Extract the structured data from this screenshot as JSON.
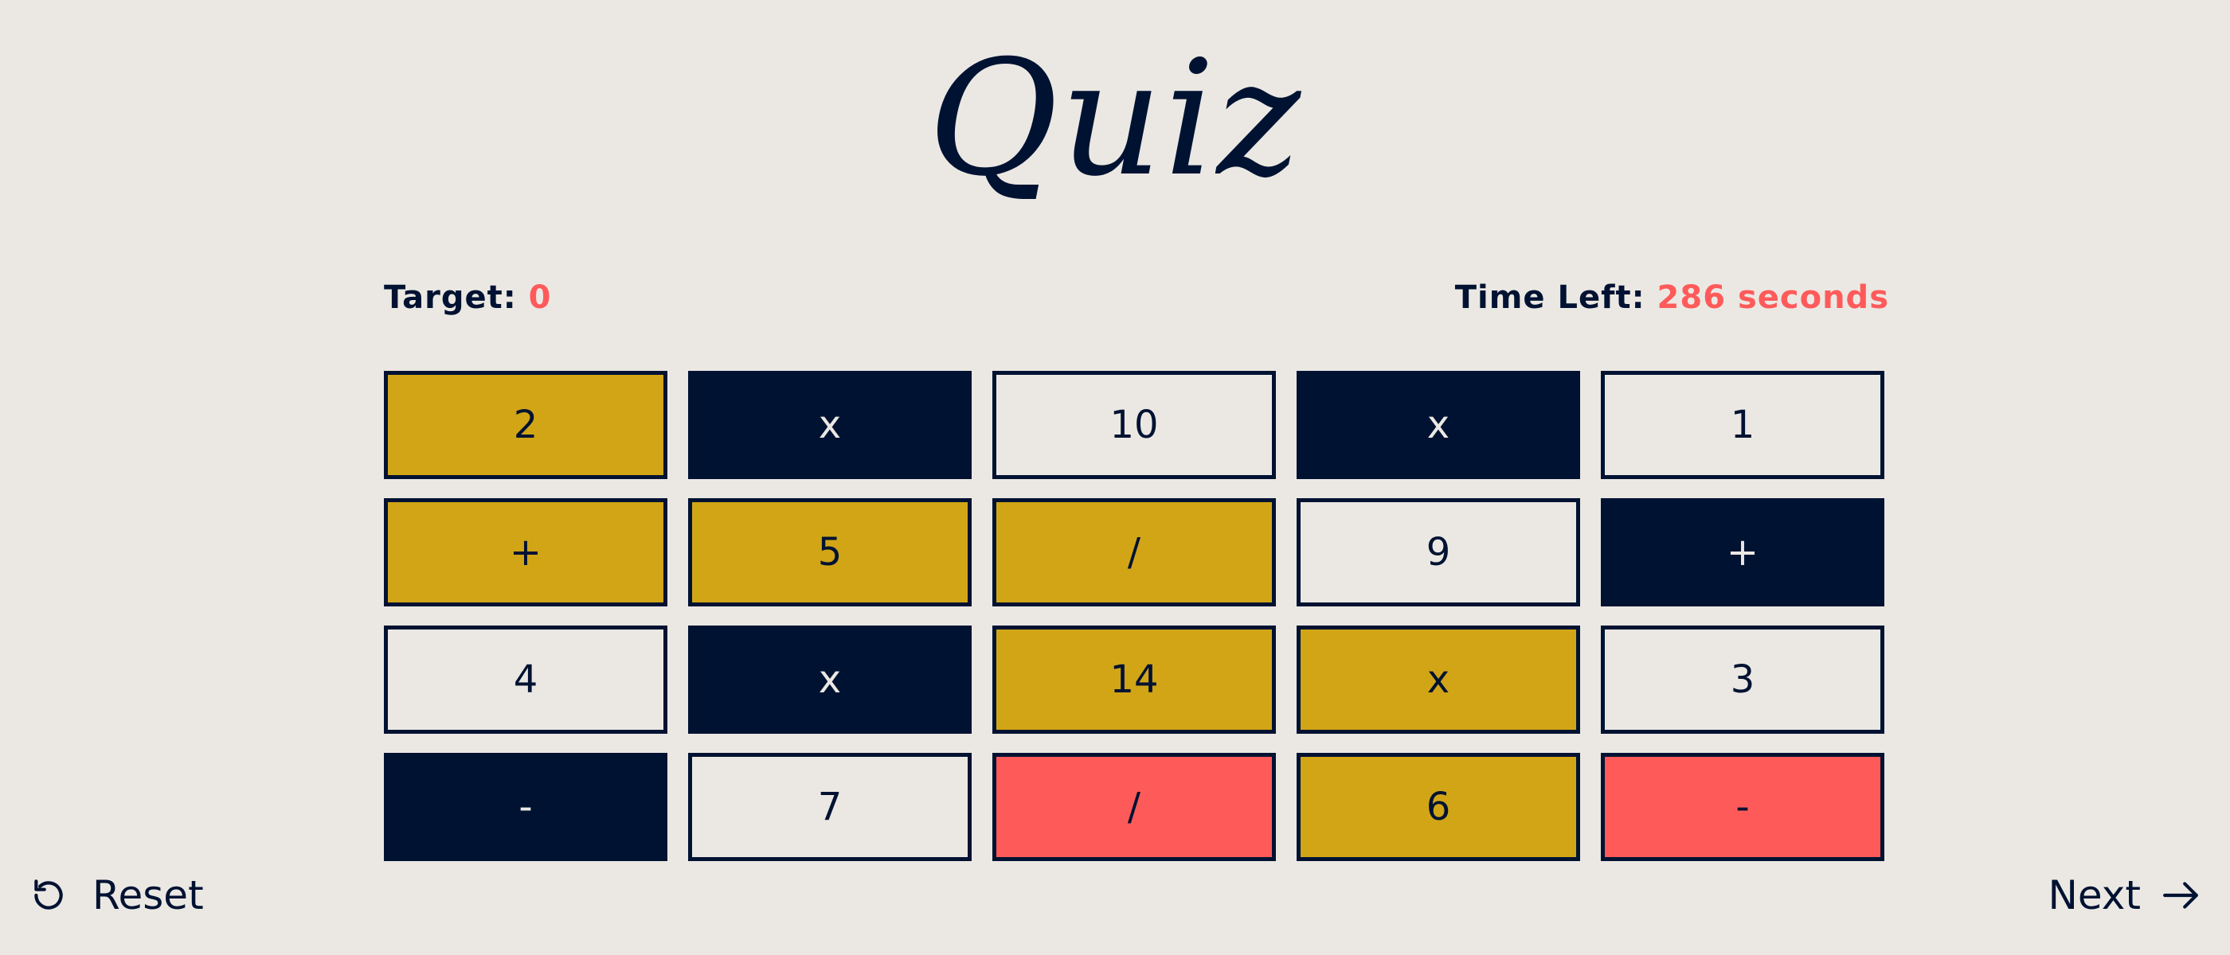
{
  "header": {
    "title": "Quiz"
  },
  "stats": {
    "target_label": "Target:",
    "target_value": "0",
    "time_label": "Time Left:",
    "time_value": "286 seconds"
  },
  "board": {
    "tiles": [
      {
        "label": "2",
        "state": "gold"
      },
      {
        "label": "x",
        "state": "dark"
      },
      {
        "label": "10",
        "state": "blank"
      },
      {
        "label": "x",
        "state": "dark"
      },
      {
        "label": "1",
        "state": "blank"
      },
      {
        "label": "+",
        "state": "gold"
      },
      {
        "label": "5",
        "state": "gold"
      },
      {
        "label": "/",
        "state": "gold"
      },
      {
        "label": "9",
        "state": "blank"
      },
      {
        "label": "+",
        "state": "dark"
      },
      {
        "label": "4",
        "state": "blank"
      },
      {
        "label": "x",
        "state": "dark"
      },
      {
        "label": "14",
        "state": "gold"
      },
      {
        "label": "x",
        "state": "gold"
      },
      {
        "label": "3",
        "state": "blank"
      },
      {
        "label": "-",
        "state": "dark"
      },
      {
        "label": "7",
        "state": "blank"
      },
      {
        "label": "/",
        "state": "red"
      },
      {
        "label": "6",
        "state": "gold"
      },
      {
        "label": "-",
        "state": "red"
      }
    ]
  },
  "footer": {
    "reset_label": "Reset",
    "reset_icon": "reset-icon",
    "next_label": "Next",
    "next_icon": "arrow-right-icon"
  },
  "colors": {
    "background": "#ebe8e3",
    "navy": "#001232",
    "gold": "#d1a516",
    "accent_red": "#ff5a5a"
  }
}
